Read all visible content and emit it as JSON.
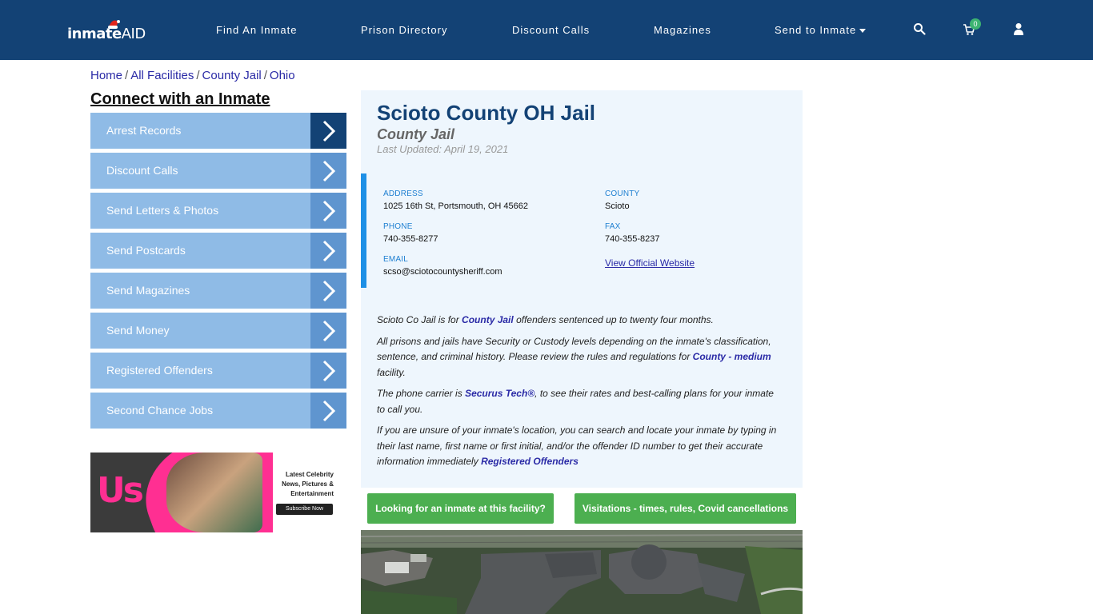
{
  "brand": {
    "name_bold": "inmate",
    "name_thin": "AID"
  },
  "nav": {
    "items": [
      "Find An Inmate",
      "Prison Directory",
      "Discount Calls",
      "Magazines",
      "Send to Inmate"
    ],
    "cart_count": "0"
  },
  "breadcrumb": [
    "Home",
    "All Facilities",
    "County Jail",
    "Ohio"
  ],
  "sidebar": {
    "title": "Connect with an Inmate",
    "items": [
      "Arrest Records",
      "Discount Calls",
      "Send Letters & Photos",
      "Send Postcards",
      "Send Magazines",
      "Send Money",
      "Registered Offenders",
      "Second Chance Jobs"
    ]
  },
  "ad": {
    "logo": "Us",
    "line1": "Latest Celebrity",
    "line2": "News, Pictures &",
    "line3": "Entertainment",
    "cta": "Subscribe Now"
  },
  "facility": {
    "title": "Scioto County OH Jail",
    "type": "County Jail",
    "updated": "Last Updated: April 19, 2021",
    "address_label": "ADDRESS",
    "address": "1025 16th St, Portsmouth, OH 45662",
    "county_label": "COUNTY",
    "county": "Scioto",
    "phone_label": "PHONE",
    "phone": "740-355-8277",
    "fax_label": "FAX",
    "fax": "740-355-8237",
    "email_label": "EMAIL",
    "email": "scso@sciotocountysheriff.com",
    "website_link": "View Official Website"
  },
  "description": {
    "p1_a": "Scioto Co Jail is for ",
    "p1_link": "County Jail",
    "p1_b": " offenders sentenced up to twenty four months.",
    "p2_a": "All prisons and jails have Security or Custody levels depending on the inmate's classification, sentence, and criminal history. Please review the rules and regulations for ",
    "p2_link": "County - medium",
    "p2_b": " facility.",
    "p3_a": "The phone carrier is ",
    "p3_link": "Securus Tech®",
    "p3_b": ", to see their rates and best-calling plans for your inmate to call you.",
    "p4_a": "If you are unsure of your inmate's location, you can search and locate your inmate by typing in their last name, first name or first initial, and/or the offender ID number to get their accurate information immediately ",
    "p4_link": "Registered Offenders"
  },
  "buttons": {
    "find_inmate": "Looking for an inmate at this facility?",
    "visitations": "Visitations - times, rules, Covid cancellations"
  },
  "colors": {
    "nav_bg": "#134275",
    "sidebar_item": "#8fbbe6",
    "accent_blue": "#1e90e6",
    "green": "#4caf50"
  }
}
